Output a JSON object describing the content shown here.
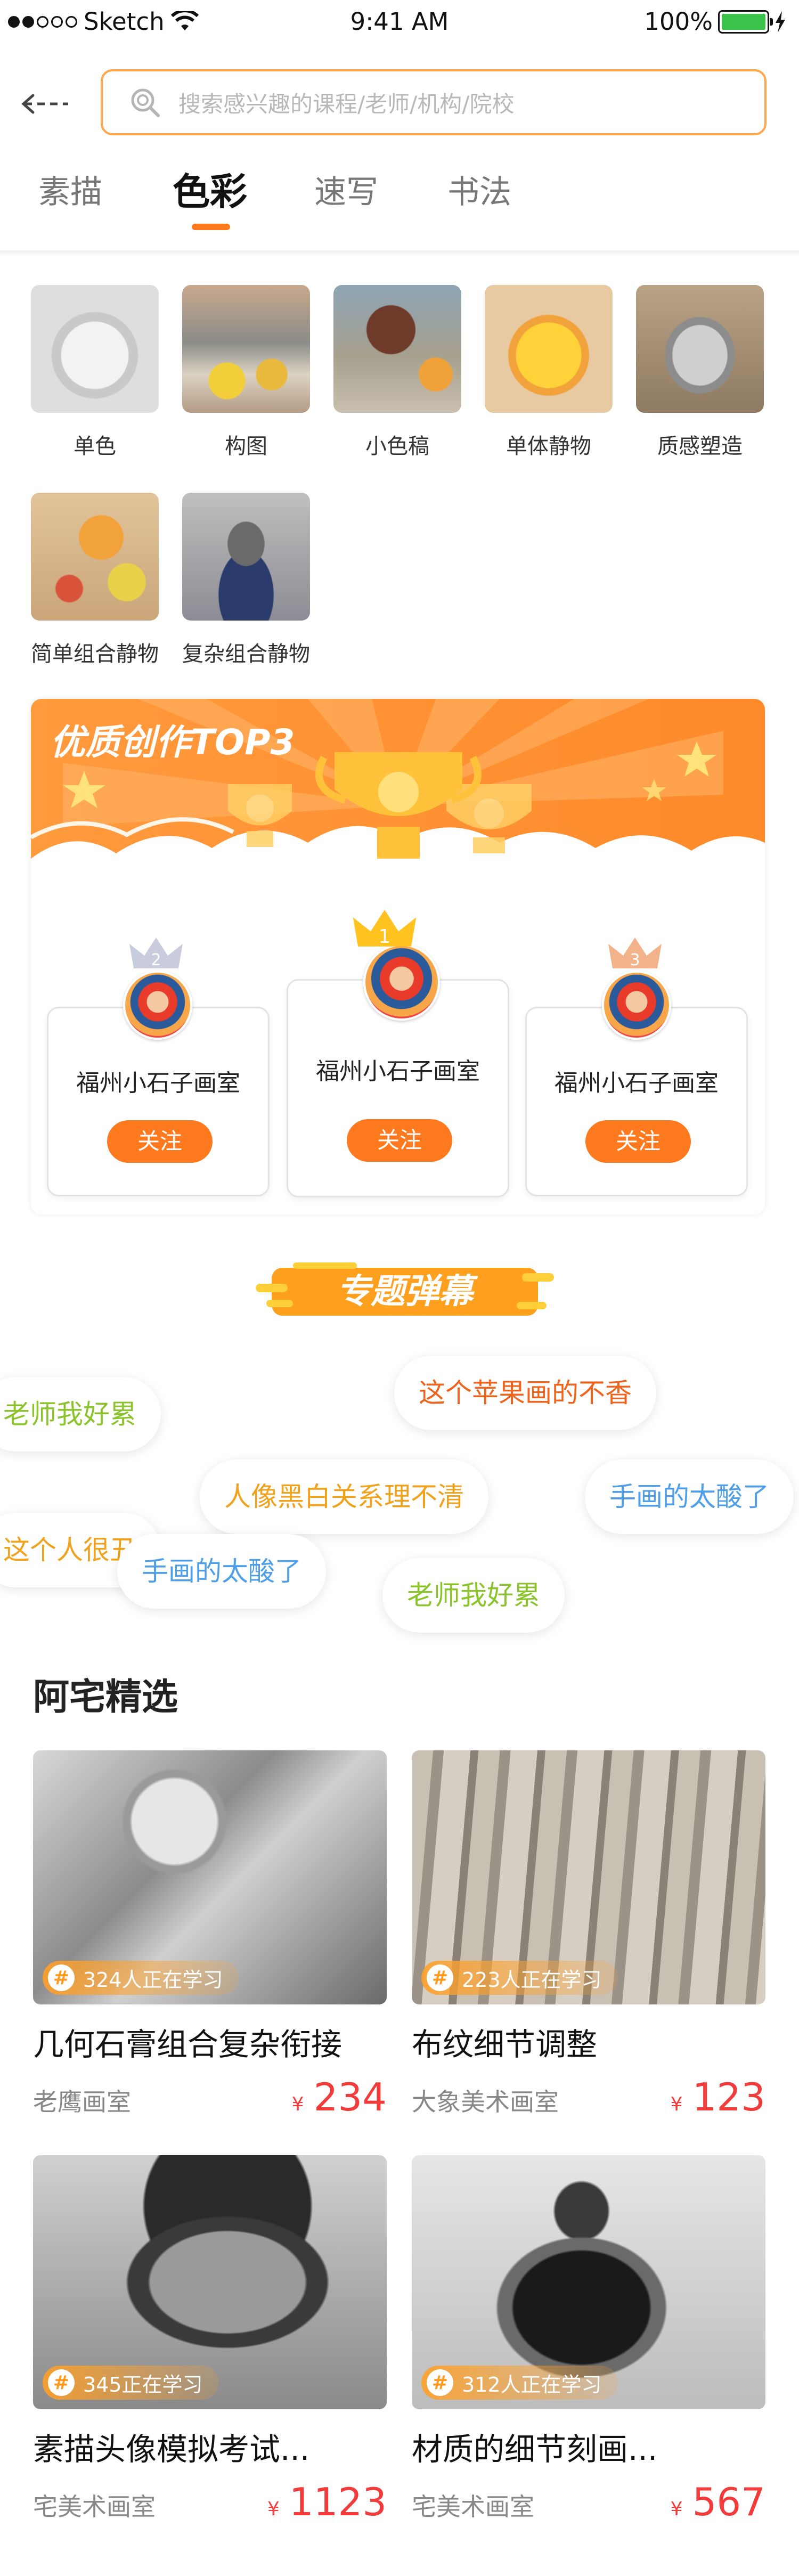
{
  "status_bar": {
    "carrier": "Sketch",
    "time": "9:41 AM",
    "battery": "100%"
  },
  "search": {
    "placeholder": "搜索感兴趣的课程/老师/机构/院校"
  },
  "tabs": [
    {
      "label": "素描",
      "active": false
    },
    {
      "label": "色彩",
      "active": true
    },
    {
      "label": "速写",
      "active": false
    },
    {
      "label": "书法",
      "active": false
    }
  ],
  "categories": [
    "单色",
    "构图",
    "小色稿",
    "单体静物",
    "质感塑造",
    "简单组合静物",
    "复杂组合静物"
  ],
  "top3": {
    "title": "优质创作TOP3",
    "studios": [
      {
        "rank": "2",
        "name": "福州小石子画室",
        "follow": "关注"
      },
      {
        "rank": "1",
        "name": "福州小石子画室",
        "follow": "关注"
      },
      {
        "rank": "3",
        "name": "福州小石子画室",
        "follow": "关注"
      }
    ]
  },
  "danmaku": {
    "title": "专题弹幕",
    "items": [
      {
        "text": "老师我好累",
        "color": "#8ac32a"
      },
      {
        "text": "这个苹果画的不香",
        "color": "#f0631c"
      },
      {
        "text": "人像黑白关系理不清",
        "color": "#f0a21c"
      },
      {
        "text": "手画的太酸了",
        "color": "#4e9ee8"
      },
      {
        "text": "这个人很丑",
        "color": "#f0a21c"
      },
      {
        "text": "手画的太酸了",
        "color": "#4e9ee8"
      },
      {
        "text": "老师我好累",
        "color": "#8ac32a"
      }
    ]
  },
  "featured": {
    "title": "阿宅精选",
    "courses": [
      {
        "title": "几何石膏组合复杂衔接",
        "learners": "324人正在学习",
        "studio": "老鹰画室",
        "currency": "¥",
        "price": "234"
      },
      {
        "title": "布纹细节调整",
        "learners": "223人正在学习",
        "studio": "大象美术画室",
        "currency": "¥",
        "price": "123"
      },
      {
        "title": "素描头像模拟考试...",
        "learners": "345正在学习",
        "studio": "宅美术画室",
        "currency": "¥",
        "price": "1123"
      },
      {
        "title": "材质的细节刻画...",
        "learners": "312人正在学习",
        "studio": "宅美术画室",
        "currency": "¥",
        "price": "567"
      }
    ]
  },
  "colors": {
    "accent": "#ff7a1e",
    "price": "#f23c3c",
    "search_border": "#ffa64a"
  }
}
